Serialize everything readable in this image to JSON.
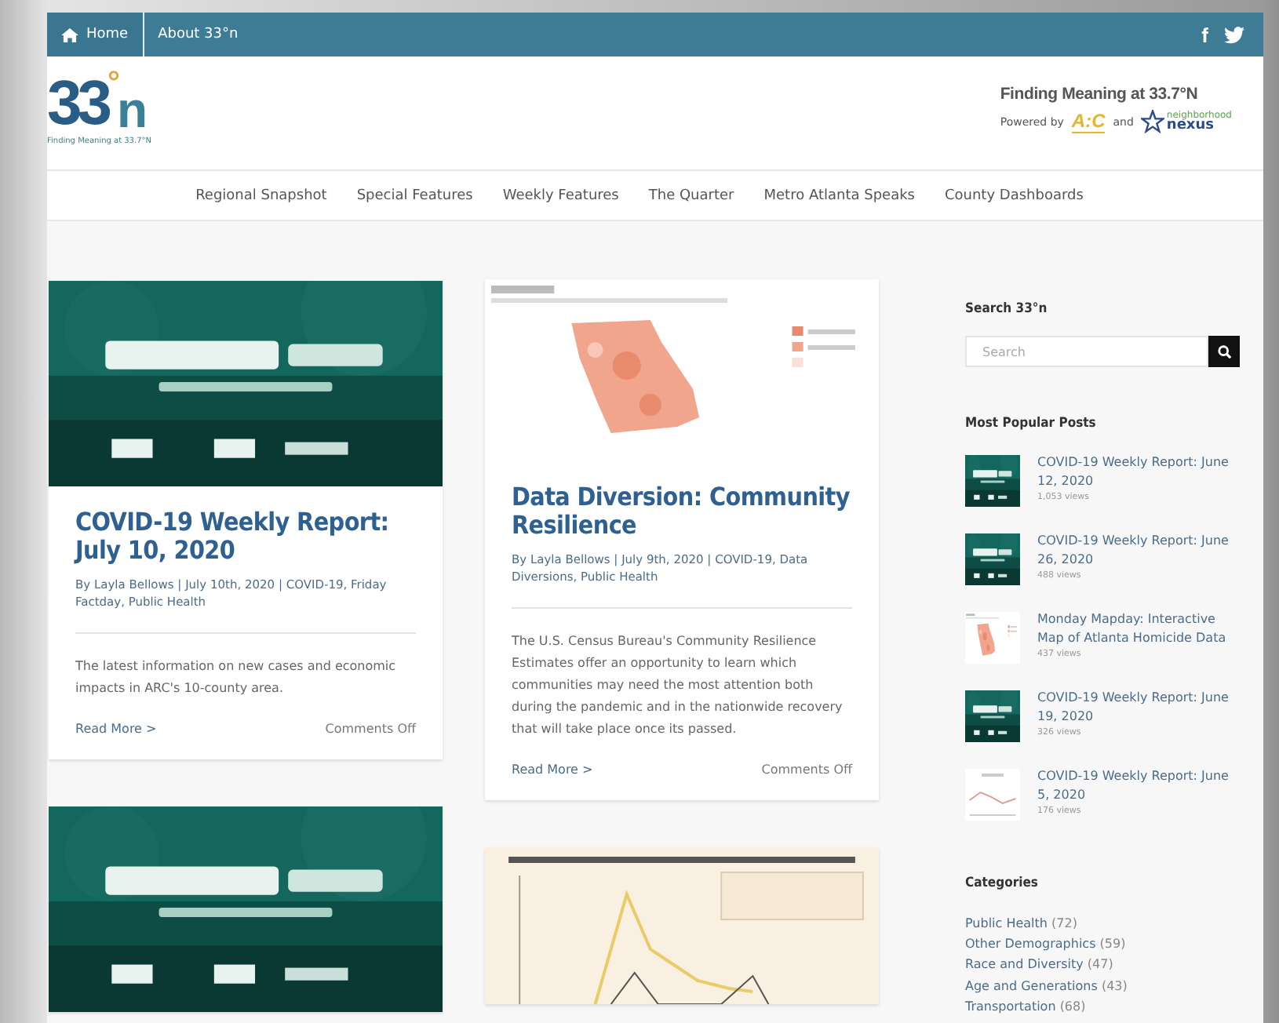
{
  "topbar": {
    "links": [
      {
        "label": "Home",
        "selected": true
      },
      {
        "label": "About 33°n",
        "selected": false
      }
    ],
    "social": [
      {
        "kind": "facebook",
        "label": "f"
      },
      {
        "kind": "twitter"
      }
    ]
  },
  "header": {
    "logo": {
      "mark": "33",
      "degree": "°",
      "letter": "n",
      "tagline": "Finding Meaning at 33.7°N"
    },
    "tagline": "Finding Meaning at 33.7°N",
    "powered_by": "Powered by",
    "partner_1": "A:C",
    "and": "and",
    "partner_2_top": "neighborhood",
    "partner_2_bottom": "nexus"
  },
  "nav": [
    "Regional Snapshot",
    "Special Features",
    "Weekly Features",
    "The Quarter",
    "Metro Atlanta Speaks",
    "County Dashboards"
  ],
  "columns": [
    [
      {
        "kind": "post",
        "title": "COVID-19 Weekly Report: July 10, 2020",
        "meta": "By Layla Bellows | July 10th, 2020 | COVID-19, Friday Factday, Public Health",
        "excerpt": "The latest information on new cases and economic impacts in ARC's 10-county area.",
        "read_more": "Read More >",
        "comments": "Comments Off"
      },
      {
        "kind": "picture"
      }
    ],
    [
      {
        "kind": "post",
        "title": "Data Diversion: Community Resilience",
        "meta": "By Layla Bellows | July 9th, 2020 | COVID-19, Data Diversions, Public Health",
        "excerpt": "The U.S. Census Bureau's Community Resilience Estimates offer an opportunity to learn which communities may need the most attention both during the pandemic and in the nationwide recovery that will take place once its passed.",
        "read_more": "Read More >",
        "comments": "Comments Off"
      },
      {
        "kind": "picture"
      }
    ]
  ],
  "sidebar": {
    "search_title": "Search 33°n",
    "search": {
      "placeholder": "Search"
    },
    "popular_title": "Most Popular Posts",
    "popular": [
      {
        "title": "COVID-19 Weekly Report: June 12, 2020",
        "views": "1,053 views"
      },
      {
        "title": "COVID-19 Weekly Report: June 26, 2020",
        "views": "488 views"
      },
      {
        "title": "Monday Mapday: Interactive Map of Atlanta Homicide Data",
        "views": "437 views"
      },
      {
        "title": "COVID-19 Weekly Report: June 19, 2020",
        "views": "326 views"
      },
      {
        "title": "COVID-19 Weekly Report: June 5, 2020",
        "views": "176 views"
      }
    ],
    "categories_title": "Categories",
    "categories": [
      {
        "name": "Public Health",
        "count": "(72)"
      },
      {
        "name": "Other Demographics",
        "count": "(59)"
      },
      {
        "name": "Race and Diversity",
        "count": "(47)"
      },
      {
        "name": "Age and Generations",
        "count": "(43)"
      },
      {
        "name": "Transportation",
        "count": "(68)"
      }
    ]
  }
}
